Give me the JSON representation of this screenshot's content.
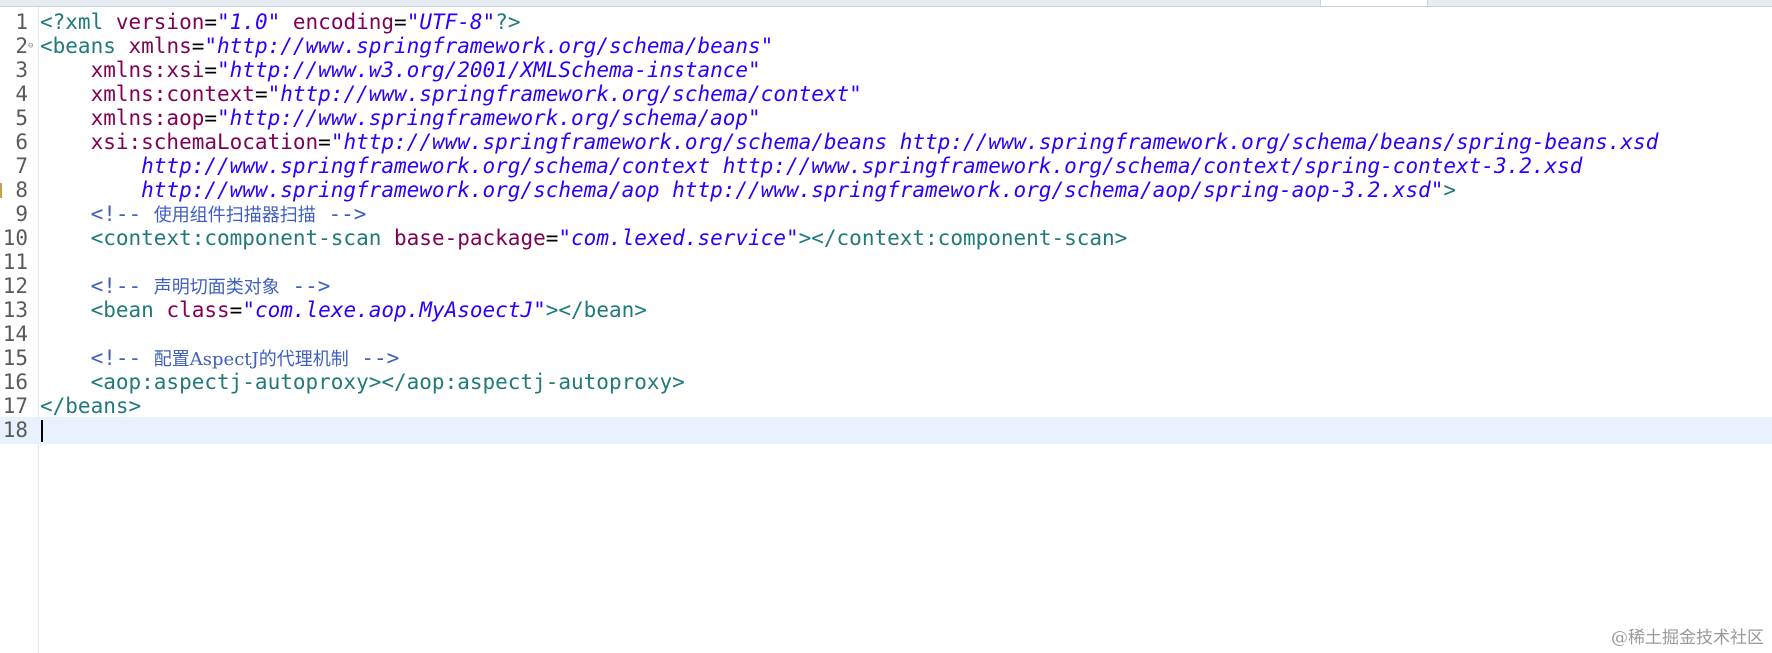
{
  "editor": {
    "lines": [
      {
        "n": "1",
        "segments": [
          {
            "t": "<?xml ",
            "c": "tag"
          },
          {
            "t": "version",
            "c": "attr"
          },
          {
            "t": "=",
            "c": "pun"
          },
          {
            "t": "\"1.0\"",
            "c": "val"
          },
          {
            "t": " encoding",
            "c": "attr"
          },
          {
            "t": "=",
            "c": "pun"
          },
          {
            "t": "\"UTF-8\"",
            "c": "val"
          },
          {
            "t": "?>",
            "c": "tag"
          }
        ]
      },
      {
        "n": "2",
        "fold": true,
        "segments": [
          {
            "t": "<beans ",
            "c": "tag"
          },
          {
            "t": "xmlns",
            "c": "attr"
          },
          {
            "t": "=",
            "c": "pun"
          },
          {
            "t": "\"http://www.springframework.org/schema/beans\"",
            "c": "val"
          }
        ]
      },
      {
        "n": "3",
        "segments": [
          {
            "t": "    xmlns:xsi",
            "c": "attr"
          },
          {
            "t": "=",
            "c": "pun"
          },
          {
            "t": "\"http://www.w3.org/2001/XMLSchema-instance\"",
            "c": "val"
          }
        ]
      },
      {
        "n": "4",
        "segments": [
          {
            "t": "    xmlns:context",
            "c": "attr"
          },
          {
            "t": "=",
            "c": "pun"
          },
          {
            "t": "\"http://www.springframework.org/schema/context\"",
            "c": "val"
          }
        ]
      },
      {
        "n": "5",
        "segments": [
          {
            "t": "    xmlns:aop",
            "c": "attr"
          },
          {
            "t": "=",
            "c": "pun"
          },
          {
            "t": "\"http://www.springframework.org/schema/aop\"",
            "c": "val"
          }
        ]
      },
      {
        "n": "6",
        "segments": [
          {
            "t": "    xsi:schemaLocation",
            "c": "attr"
          },
          {
            "t": "=",
            "c": "pun"
          },
          {
            "t": "\"http://www.springframework.org/schema/beans http://www.springframework.org/schema/beans/spring-beans.xsd",
            "c": "val"
          }
        ]
      },
      {
        "n": "7",
        "segments": [
          {
            "t": "        http://www.springframework.org/schema/context http://www.springframework.org/schema/context/spring-context-3.2.xsd",
            "c": "val"
          }
        ]
      },
      {
        "n": "8",
        "marker": true,
        "segments": [
          {
            "t": "        http://www.springframework.org/schema/aop http://www.springframework.org/schema/aop/spring-aop-3.2.xsd\"",
            "c": "val"
          },
          {
            "t": ">",
            "c": "tag"
          }
        ]
      },
      {
        "n": "9",
        "segments": [
          {
            "t": "    <!-- ",
            "c": "com"
          },
          {
            "t": "使用组件扫描器扫描",
            "c": "com cjk"
          },
          {
            "t": " -->",
            "c": "com"
          }
        ]
      },
      {
        "n": "10",
        "segments": [
          {
            "t": "    <context:component-scan ",
            "c": "tag"
          },
          {
            "t": "base-package",
            "c": "attr"
          },
          {
            "t": "=",
            "c": "pun"
          },
          {
            "t": "\"com.lexed.service\"",
            "c": "val"
          },
          {
            "t": "></context:component-scan>",
            "c": "tag"
          }
        ]
      },
      {
        "n": "11",
        "segments": []
      },
      {
        "n": "12",
        "segments": [
          {
            "t": "    <!-- ",
            "c": "com"
          },
          {
            "t": "声明切面类对象",
            "c": "com cjk"
          },
          {
            "t": " -->",
            "c": "com"
          }
        ]
      },
      {
        "n": "13",
        "segments": [
          {
            "t": "    <bean ",
            "c": "tag"
          },
          {
            "t": "class",
            "c": "attr"
          },
          {
            "t": "=",
            "c": "pun"
          },
          {
            "t": "\"com.lexe.aop.MyAsoectJ\"",
            "c": "val"
          },
          {
            "t": "></bean>",
            "c": "tag"
          }
        ]
      },
      {
        "n": "14",
        "segments": []
      },
      {
        "n": "15",
        "segments": [
          {
            "t": "    <!-- ",
            "c": "com"
          },
          {
            "t": "配置AspectJ的代理机制",
            "c": "com cjk"
          },
          {
            "t": " -->",
            "c": "com"
          }
        ]
      },
      {
        "n": "16",
        "segments": [
          {
            "t": "    <aop:aspectj-autoproxy></aop:aspectj-autoproxy>",
            "c": "tag"
          }
        ]
      },
      {
        "n": "17",
        "segments": [
          {
            "t": "</beans>",
            "c": "tag"
          }
        ]
      },
      {
        "n": "18",
        "current": true,
        "caret": true,
        "segments": []
      }
    ]
  },
  "watermark": "@稀土掘金技术社区"
}
